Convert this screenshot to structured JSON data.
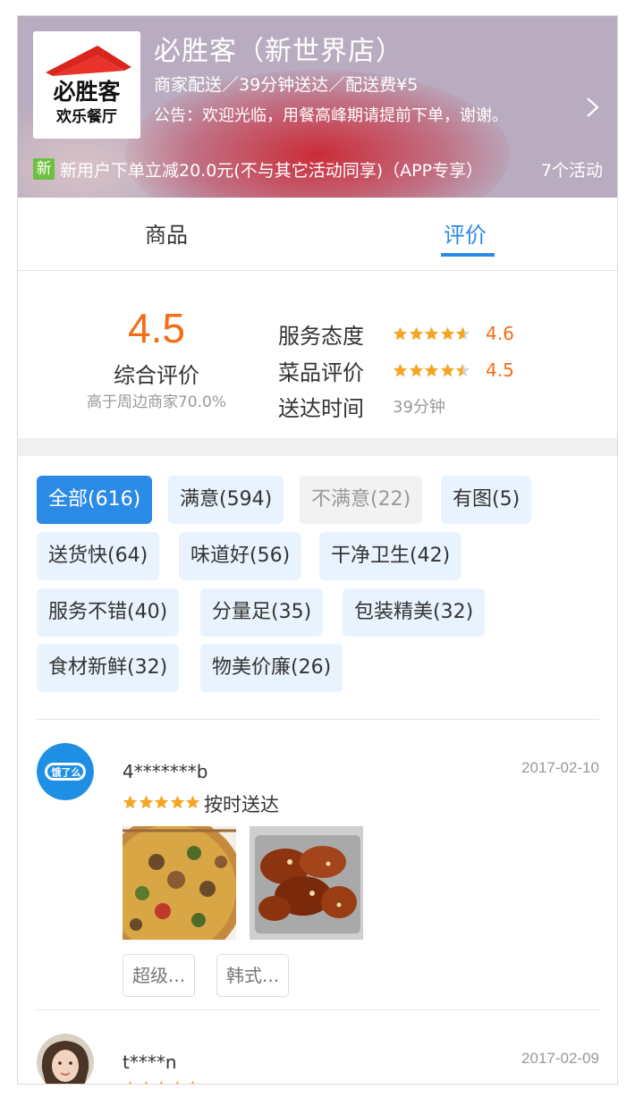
{
  "shop": {
    "name": "必胜客（新世界店）",
    "meta": "商家配送／39分钟送达／配送费¥5",
    "notice": "公告：欢迎光临，用餐高峰期请提前下单，谢谢。",
    "logo_text_1": "必胜客",
    "logo_text_2": "欢乐餐厅",
    "promo_badge": "新",
    "promo_text": "新用户下单立减20.0元(不与其它活动同享)（APP专享）",
    "activities": "7个活动"
  },
  "tabs": [
    {
      "label": "商品",
      "active": false
    },
    {
      "label": "评价",
      "active": true
    }
  ],
  "summary": {
    "score": "4.5",
    "score_label": "综合评价",
    "score_sub": "高于周边商家70.0%",
    "rows": [
      {
        "label": "服务态度",
        "rating": 4.6,
        "value": "4.6"
      },
      {
        "label": "菜品评价",
        "rating": 4.5,
        "value": "4.5"
      },
      {
        "label": "送达时间",
        "value": "39分钟"
      }
    ]
  },
  "filter_tags": [
    {
      "label": "全部(616)",
      "state": "active"
    },
    {
      "label": "满意(594)",
      "state": "normal"
    },
    {
      "label": "不满意(22)",
      "state": "negative"
    },
    {
      "label": "有图(5)",
      "state": "normal"
    },
    {
      "label": "送货快(64)",
      "state": "normal"
    },
    {
      "label": "味道好(56)",
      "state": "normal"
    },
    {
      "label": "干净卫生(42)",
      "state": "normal"
    },
    {
      "label": "服务不错(40)",
      "state": "normal"
    },
    {
      "label": "分量足(35)",
      "state": "normal"
    },
    {
      "label": "包装精美(32)",
      "state": "normal"
    },
    {
      "label": "食材新鲜(32)",
      "state": "normal"
    },
    {
      "label": "物美价廉(26)",
      "state": "normal"
    }
  ],
  "reviews": [
    {
      "user": "4*******b",
      "date": "2017-02-10",
      "rating": 5,
      "text": "按时送达",
      "avatar_text": "饿了么",
      "chips": [
        "超级...",
        "韩式..."
      ]
    },
    {
      "user": "t****n",
      "date": "2017-02-09",
      "rating": 5,
      "text": ""
    }
  ],
  "colors": {
    "accent": "#2b8ae6",
    "score": "#f46d16",
    "star": "#f5a623",
    "promo_badge": "#6cc13e"
  }
}
